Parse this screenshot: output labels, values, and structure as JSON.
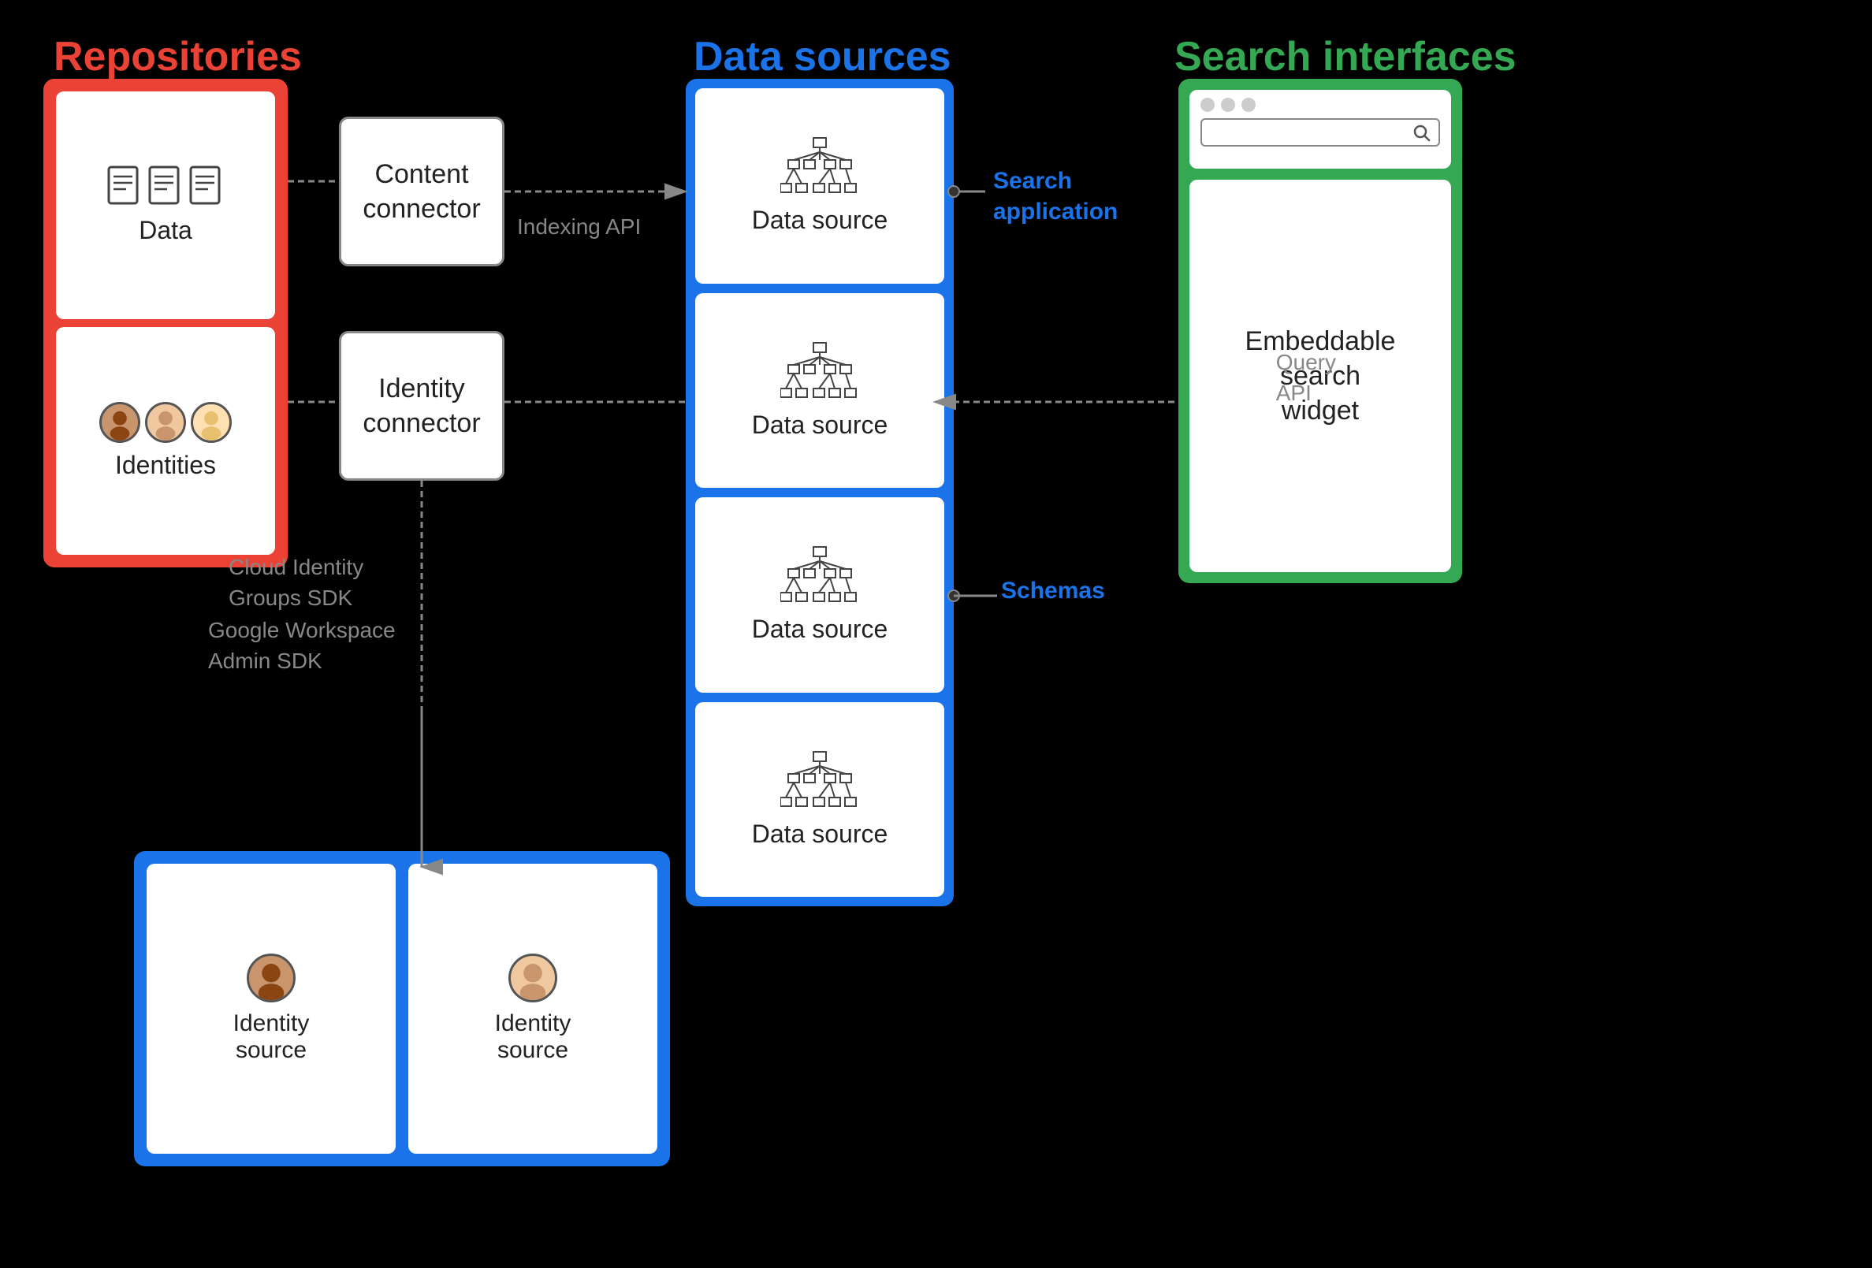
{
  "sections": {
    "repositories": "Repositories",
    "datasources": "Data sources",
    "searchinterfaces": "Search interfaces"
  },
  "repositories": {
    "data_label": "Data",
    "identities_label": "Identities"
  },
  "connectors": {
    "content_connector": "Content\nconnector",
    "identity_connector": "Identity\nconnector"
  },
  "datasources": {
    "items": [
      {
        "label": "Data source"
      },
      {
        "label": "Data source"
      },
      {
        "label": "Data source"
      },
      {
        "label": "Data source"
      }
    ]
  },
  "identity_sources": {
    "items": [
      {
        "label": "Identity\nsource"
      },
      {
        "label": "Identity\nsource"
      }
    ]
  },
  "search_interfaces": {
    "embeddable_label": "Embeddable\nsearch\nwidget",
    "search_button": "Search"
  },
  "labels": {
    "indexing_api": "Indexing API",
    "cloud_identity": "Cloud Identity\nGroups SDK",
    "google_workspace": "Google Workspace\nAdmin SDK",
    "search_application": "Search\napplication",
    "query_api": "Query\nAPI",
    "schemas": "Schemas"
  }
}
